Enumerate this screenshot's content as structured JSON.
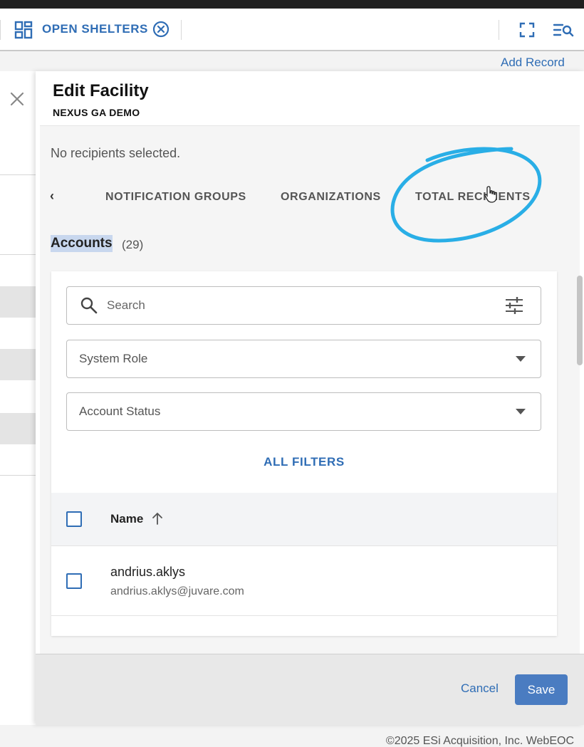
{
  "header": {
    "title": "OPEN SHELTERS",
    "add_record": "Add Record"
  },
  "drawer": {
    "title": "Edit Facility",
    "subtitle": "NEXUS GA DEMO",
    "no_recipients": "No recipients selected.",
    "tabs": [
      {
        "label": "NOTIFICATION GROUPS"
      },
      {
        "label": "ORGANIZATIONS"
      },
      {
        "label": "TOTAL RECIPIENTS"
      }
    ],
    "accounts": {
      "title": "Accounts",
      "count": "(29)"
    },
    "filters": {
      "search_placeholder": "Search",
      "system_role": "System Role",
      "account_status": "Account Status",
      "all_filters": "ALL FILTERS"
    },
    "table": {
      "name_header": "Name",
      "rows": [
        {
          "name": "andrius.aklys",
          "email": "andrius.aklys@juvare.com"
        }
      ]
    },
    "footer": {
      "cancel": "Cancel",
      "save": "Save"
    }
  },
  "copyright": "©2025 ESi Acquisition, Inc. WebEOC",
  "colors": {
    "accent": "#2f6db5",
    "save_button": "#4a7cc1",
    "annotation": "#29aee6",
    "highlight": "#c8d7ee"
  }
}
